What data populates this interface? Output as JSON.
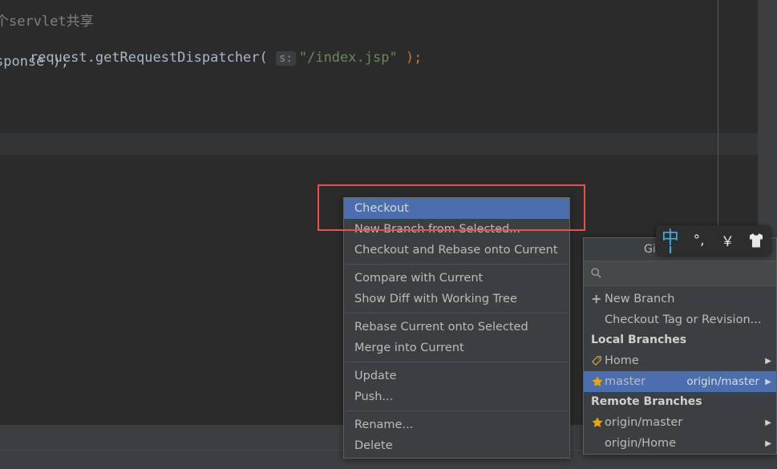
{
  "editor": {
    "comment_line": "个servlet共享",
    "code_line_prefix": "request.getRequestDispatcher( ",
    "param_hint": "s:",
    "string_literal": "\"/index.jsp\"",
    "code_line_suffix": " );",
    "tail_line": "sponse );"
  },
  "context_menu": {
    "items": [
      {
        "label": "Checkout",
        "selected": true
      },
      {
        "label": "New Branch from Selected...",
        "selected": false
      },
      {
        "label": "Checkout and Rebase onto Current",
        "selected": false
      },
      {
        "label": "Compare with Current",
        "selected": false
      },
      {
        "label": "Show Diff with Working Tree",
        "selected": false
      },
      {
        "label": "Rebase Current onto Selected",
        "selected": false
      },
      {
        "label": "Merge into Current",
        "selected": false
      },
      {
        "label": "Update",
        "selected": false
      },
      {
        "label": "Push...",
        "selected": false
      },
      {
        "label": "Rename...",
        "selected": false
      },
      {
        "label": "Delete",
        "selected": false
      }
    ]
  },
  "git_popup": {
    "title": "Git Branches",
    "refresh_icon": "refresh-icon",
    "expand_icon": "expand-icon",
    "search": {
      "value": "",
      "placeholder": ""
    },
    "actions": [
      {
        "label": "New Branch",
        "icon": "plus-icon"
      },
      {
        "label": "Checkout Tag or Revision...",
        "icon": "none"
      }
    ],
    "local_section": "Local Branches",
    "local_branches": [
      {
        "label": "Home",
        "icon": "tag-icon",
        "tracking": "",
        "selected": false,
        "arrow": "▶"
      },
      {
        "label": "master",
        "icon": "star-icon",
        "tracking": "origin/master",
        "selected": true,
        "arrow": "▶"
      }
    ],
    "remote_section": "Remote Branches",
    "remote_branches": [
      {
        "label": "origin/master",
        "icon": "star-icon",
        "tracking": "",
        "selected": false,
        "arrow": "▶"
      },
      {
        "label": "origin/Home",
        "icon": "none",
        "tracking": "",
        "selected": false,
        "arrow": "▶"
      }
    ]
  },
  "ime_bar": {
    "mode_label": "中",
    "punctuation_label": "°,",
    "width_label": "￥",
    "skin_icon": "shirt-icon"
  },
  "colors": {
    "selection_blue": "#4b6eaf",
    "annotation_red": "#e84f4f",
    "star_yellow": "#f0a30a",
    "panel_bg": "#3c3f41",
    "editor_bg": "#2b2b2b",
    "ime_accent": "#29b6f6"
  }
}
